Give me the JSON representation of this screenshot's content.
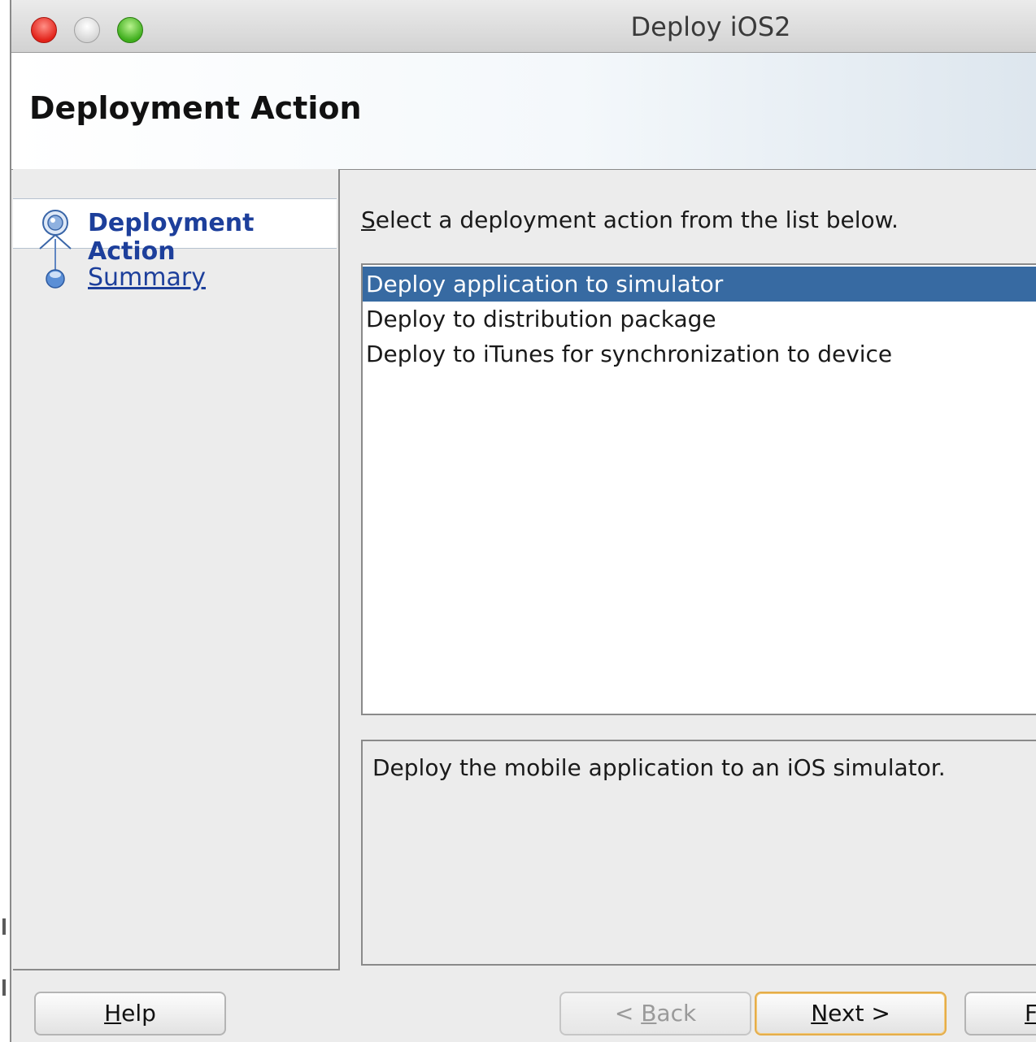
{
  "window": {
    "title": "Deploy iOS2"
  },
  "header": {
    "title": "Deployment Action"
  },
  "nav": {
    "steps": [
      {
        "label": "Deployment Action",
        "state": "current",
        "icon": "current-step-icon"
      },
      {
        "label": "Summary",
        "state": "link",
        "icon": "step-node-icon"
      }
    ]
  },
  "main": {
    "prompt_mnemonic": "S",
    "prompt_rest": "elect a deployment action from the list below.",
    "actions": [
      {
        "label": "Deploy application to simulator",
        "selected": true
      },
      {
        "label": "Deploy to distribution package",
        "selected": false
      },
      {
        "label": "Deploy to iTunes for synchronization to device",
        "selected": false
      }
    ],
    "description": "Deploy the mobile application to an iOS simulator."
  },
  "buttons": {
    "help": {
      "mnemonic": "H",
      "rest": "elp"
    },
    "back": {
      "prefix": "< ",
      "mnemonic": "B",
      "rest": "ack",
      "enabled": false
    },
    "next": {
      "mnemonic": "N",
      "rest": "ext >"
    },
    "finish": {
      "mnemonic": "F"
    }
  },
  "colors": {
    "selection": "#376aa2",
    "link": "#1d3f9b",
    "default_button_border": "#e5ad4a",
    "close": "#e2231a",
    "zoom": "#3fae1d"
  }
}
